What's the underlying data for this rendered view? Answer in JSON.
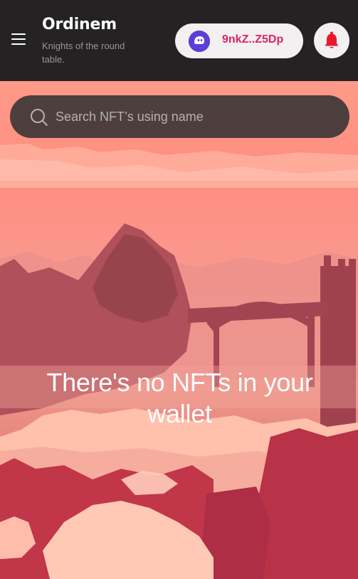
{
  "header": {
    "title": "Ordinem",
    "subtitle": "Knights of the round table.",
    "wallet_address": "9nkZ..Z5Dp"
  },
  "search": {
    "placeholder": "Search NFT’s using name"
  },
  "main": {
    "empty_message": "There's no NFTs in your wallet"
  },
  "colors": {
    "header_bg": "#242222",
    "wallet_text": "#e0245e",
    "wallet_icon": "#5b3fd6",
    "bell": "#e8192c"
  },
  "icons": [
    "menu-icon",
    "wallet-ghost-icon",
    "bell-icon",
    "search-icon"
  ]
}
